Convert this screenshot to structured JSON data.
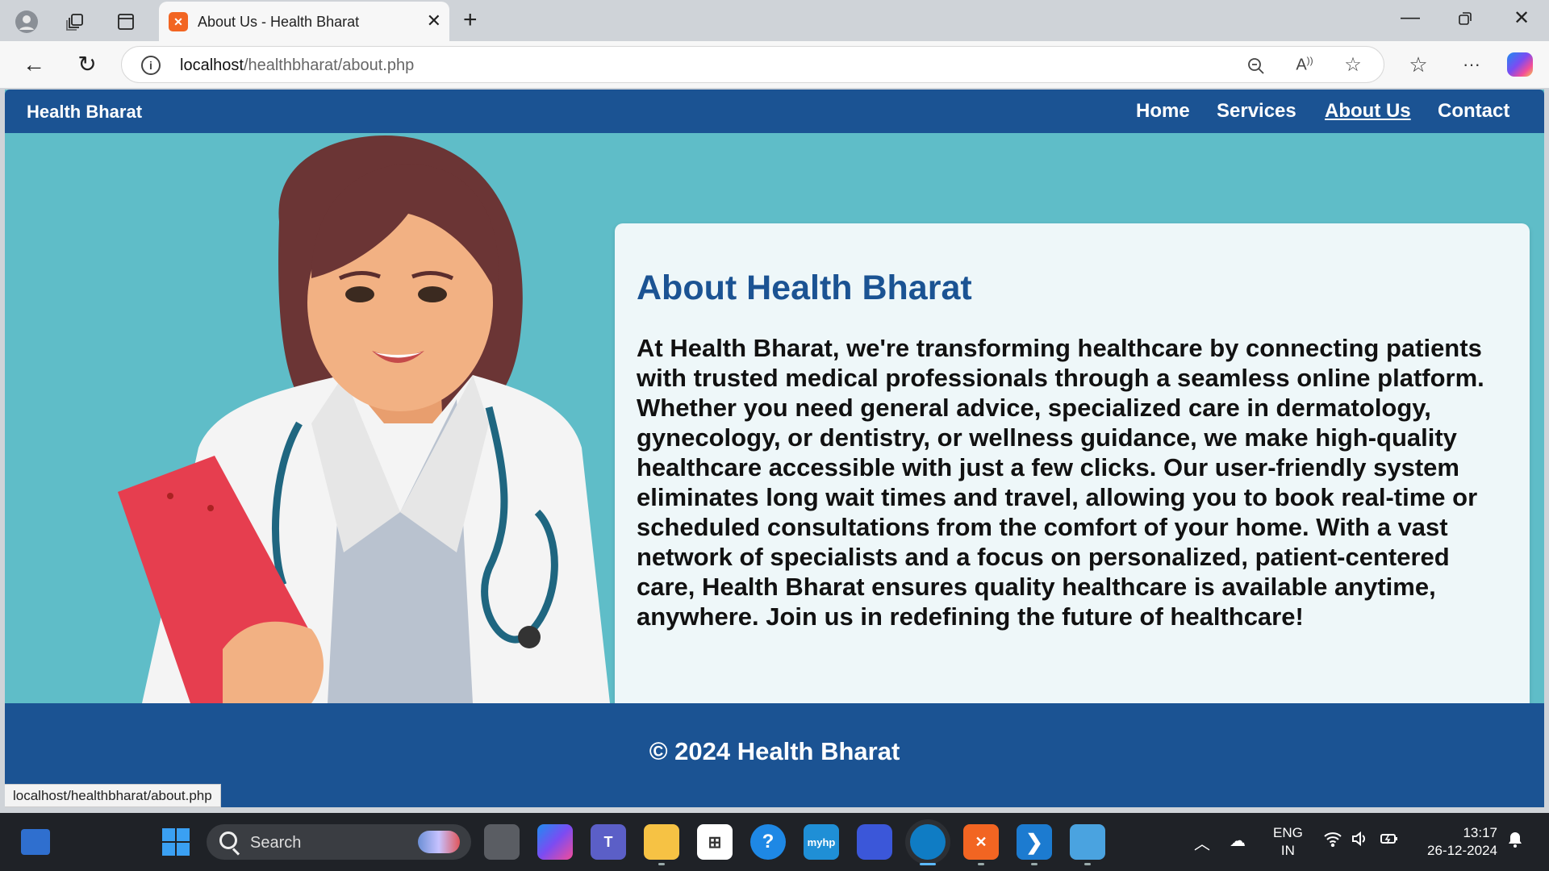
{
  "browser": {
    "tab_title": "About Us - Health Bharat",
    "url_host": "localhost",
    "url_path": "/healthbharat/about.php",
    "status_url": "localhost/healthbharat/about.php"
  },
  "site": {
    "brand": "Health Bharat",
    "nav": [
      {
        "label": "Home",
        "active": false
      },
      {
        "label": "Services",
        "active": false
      },
      {
        "label": "About Us",
        "active": true
      },
      {
        "label": "Contact",
        "active": false
      }
    ],
    "about_title": "About Health Bharat",
    "about_text": "At Health Bharat, we're transforming healthcare by connecting patients with trusted medical professionals through a seamless online platform. Whether you need general advice, specialized care in dermatology, gynecology, or dentistry, or wellness guidance, we make high-quality healthcare accessible with just a few clicks. Our user-friendly system eliminates long wait times and travel, allowing you to book real-time or scheduled consultations from the comfort of your home. With a vast network of specialists and a focus on personalized, patient-centered care, Health Bharat ensures quality healthcare is available anytime, anywhere. Join us in redefining the future of healthcare!",
    "footer": "© 2024 Health Bharat"
  },
  "colors": {
    "nav_blue": "#1b5393",
    "hero_teal": "#5fbdc8",
    "card_bg": "#eef7f9"
  },
  "taskbar": {
    "search_label": "Search",
    "lang_line1": "ENG",
    "lang_line2": "IN",
    "time": "13:17",
    "date": "26-12-2024"
  }
}
